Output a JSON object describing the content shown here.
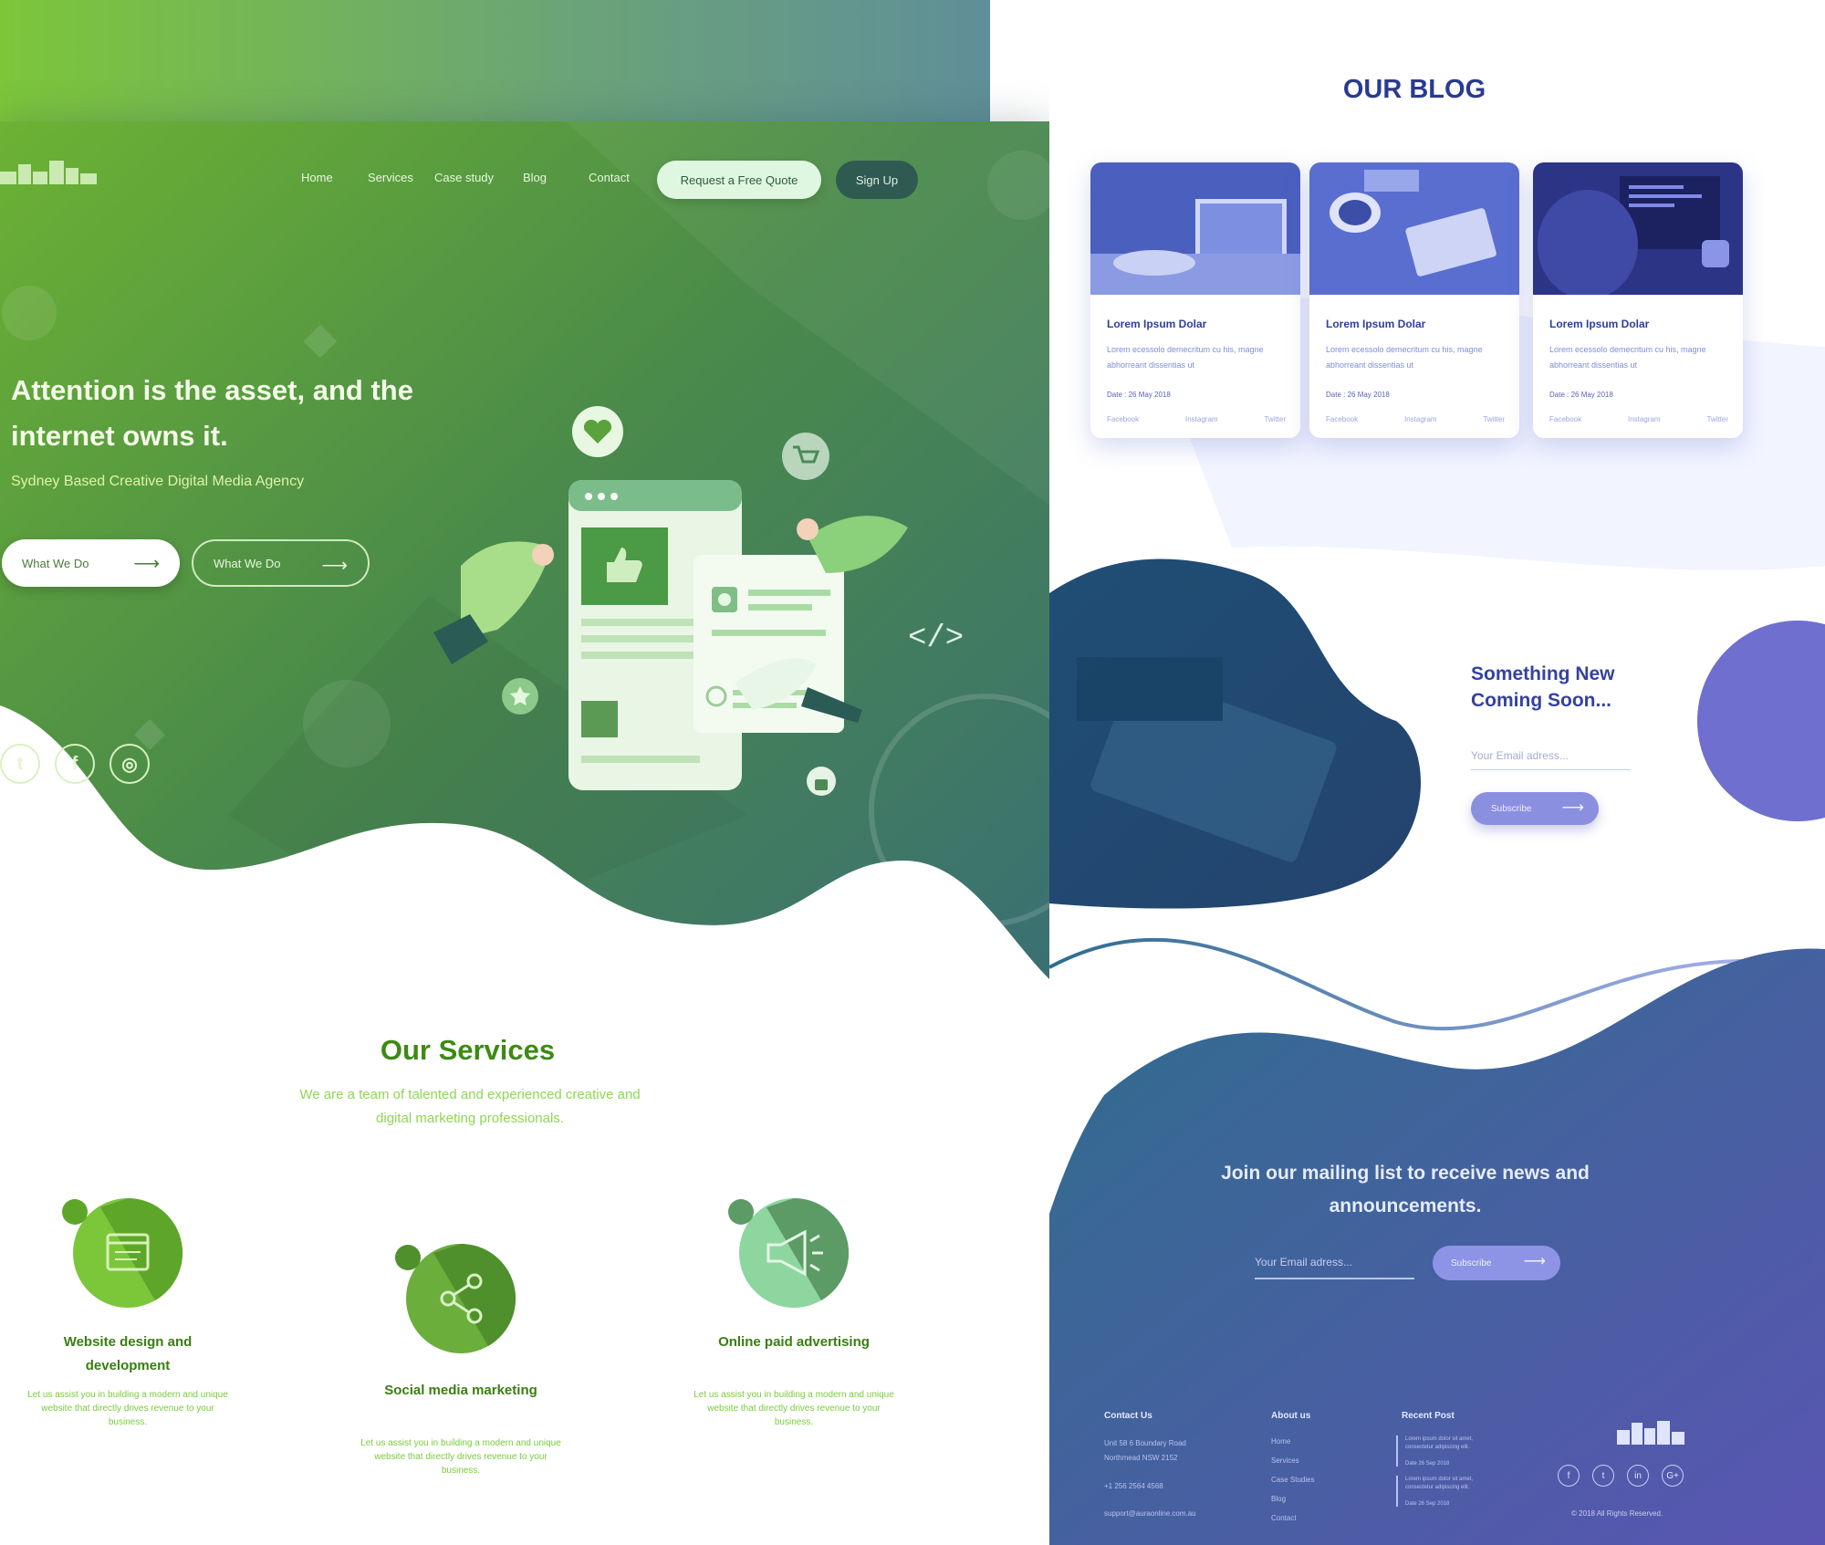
{
  "colors": {
    "green_brand": "#7cc63a",
    "teal_dark": "#2f5a52",
    "blog_blue": "#2a3a90",
    "footer_purple": "#5258b0"
  },
  "nav": {
    "links": [
      "Home",
      "Services",
      "Case study",
      "Blog",
      "Contact"
    ],
    "quote_button": "Request a Free Quote",
    "signup_button": "Sign Up"
  },
  "hero": {
    "title": "Attention is the asset, and the internet owns it.",
    "subtitle": "Sydney Based Creative Digital Media Agency",
    "button_primary": "What We Do",
    "button_secondary": "What We Do",
    "social_icons": [
      "twitter-icon",
      "facebook-icon",
      "instagram-icon"
    ]
  },
  "services": {
    "title": "Our Services",
    "subtitle": "We are a team of talented and experienced creative and digital marketing professionals.",
    "items": [
      {
        "title": "Website design and development",
        "description": "Let us assist you in building a modern and unique website that directly drives revenue to your business.",
        "icon": "browser-window-icon"
      },
      {
        "title": "Social media marketing",
        "description": "Let us assist you in building a modern and unique website that directly drives revenue to your business.",
        "icon": "share-icon"
      },
      {
        "title": "Online paid advertising",
        "description": "Let us assist you in building a modern and unique website that directly drives revenue to your business.",
        "icon": "megaphone-icon"
      }
    ]
  },
  "blog": {
    "title": "OUR BLOG",
    "cards": [
      {
        "title": "Lorem Ipsum Dolar",
        "text": "Lorem ecessolo demecritum cu his, magne abhorreant dissentias ut",
        "date": "Date : 26 May 2018",
        "links": [
          "Facebook",
          "Instagram",
          "Twitter"
        ]
      },
      {
        "title": "Lorem Ipsum Dolar",
        "text": "Lorem ecessolo demecritum cu his, magne abhorreant dissentias ut",
        "date": "Date : 26 May 2018",
        "links": [
          "Facebook",
          "Instagram",
          "Twitter"
        ]
      },
      {
        "title": "Lorem Ipsum Dolar",
        "text": "Lorem ecessolo demecritum cu his, magne abhorreant dissentias ut",
        "date": "Date : 26 May 2018",
        "links": [
          "Facebook",
          "Instagram",
          "Twitter"
        ]
      }
    ]
  },
  "coming_soon": {
    "title": "Something New Coming Soon...",
    "email_placeholder": "Your Email adress...",
    "button": "Subscribe"
  },
  "mailing": {
    "title": "Join our mailing list to receive news and announcements.",
    "email_placeholder": "Your Email adress...",
    "button": "Subscribe"
  },
  "footer": {
    "contact_heading": "Contact Us",
    "contact_lines": [
      "Unit 58 6 Boundary Road",
      "Northmead NSW 2152",
      "+1 256 2564 4568",
      "support@auraonline.com.au"
    ],
    "about_heading": "About us",
    "about_links": [
      "Home",
      "Services",
      "Case Studies",
      "Blog",
      "Contact"
    ],
    "recent_heading": "Recent Post",
    "recent_posts": [
      {
        "text": "Lorem ipsum dolor sit amet, consectetur adipiscing elit.",
        "date": "Date 26 Sep 2018"
      },
      {
        "text": "Lorem ipsum dolor sit amet, consectetur adipiscing elit.",
        "date": "Date 26 Sep 2018"
      }
    ],
    "social_icons": [
      "facebook-icon",
      "twitter-icon",
      "linkedin-icon",
      "google-plus-icon"
    ],
    "social_glyphs": [
      "f",
      "t",
      "in",
      "G+"
    ],
    "copyright": "© 2018 All Rights Reserved."
  }
}
